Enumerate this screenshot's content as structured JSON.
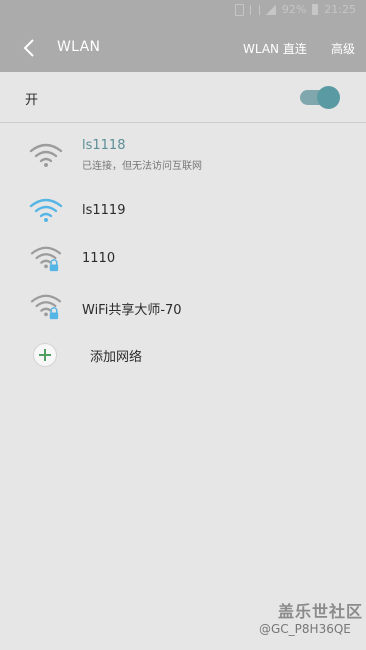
{
  "status_bar": {
    "text": "92%",
    "time": "21:25"
  },
  "header": {
    "title": "WLAN",
    "direct_label": "WLAN 直连",
    "advanced_label": "高级"
  },
  "wifi_switch": {
    "label": "开",
    "enabled": true
  },
  "networks": [
    {
      "name": "ls1118",
      "status": "已连接，但无法访问互联网",
      "connected": true,
      "locked": false,
      "icon": "wifi-icon"
    },
    {
      "name": "ls1119",
      "status": "",
      "connected": false,
      "locked": false,
      "icon": "wifi-icon"
    },
    {
      "name": "1110",
      "status": "",
      "connected": false,
      "locked": true,
      "icon": "wifi-locked-icon"
    },
    {
      "name": "WiFi共享大师-70",
      "status": "",
      "connected": false,
      "locked": true,
      "icon": "wifi-locked-icon"
    }
  ],
  "add_network": {
    "label": "添加网络",
    "icon": "plus-icon"
  },
  "watermark": {
    "brand": "盖乐世社区",
    "user": "@GC_P8H36QE"
  },
  "colors": {
    "header_bg": "#ababab",
    "page_bg": "#e6e6e6",
    "accent": "#5a9aa2",
    "wifi_blue": "#55b6e6",
    "wifi_gray": "#9c9c9c",
    "add_green": "#4f9f63"
  }
}
